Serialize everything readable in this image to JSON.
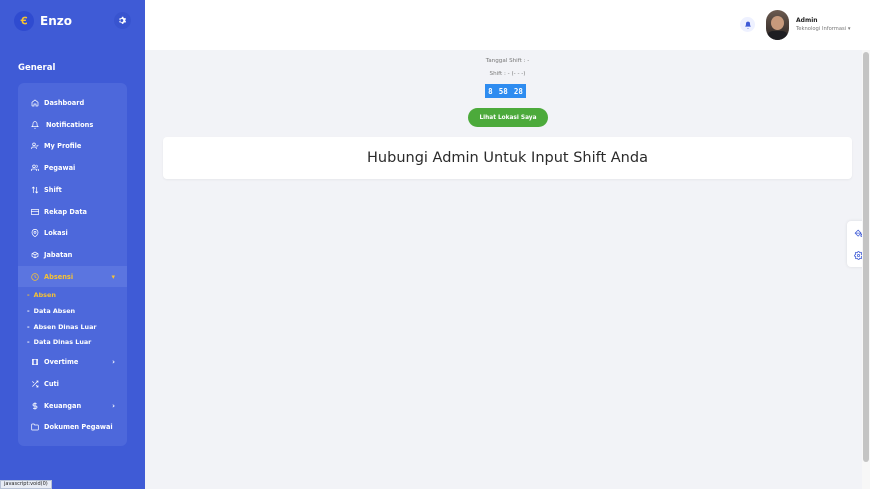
{
  "brand": {
    "name": "Enzo",
    "logo_glyph": "ꞓ"
  },
  "sidebar": {
    "section": "General",
    "items": [
      {
        "label": "Dashboard",
        "icon": "home-icon"
      },
      {
        "label": "Notifications",
        "icon": "bell-icon"
      },
      {
        "label": "My Profile",
        "icon": "user-check-icon"
      },
      {
        "label": "Pegawai",
        "icon": "users-icon"
      },
      {
        "label": "Shift",
        "icon": "arrows-updown-icon"
      },
      {
        "label": "Rekap Data",
        "icon": "credit-card-icon"
      },
      {
        "label": "Lokasi",
        "icon": "map-pin-icon"
      },
      {
        "label": "Jabatan",
        "icon": "box-icon"
      },
      {
        "label": "Absensi",
        "icon": "clock-icon",
        "active": true
      },
      {
        "label": "Overtime",
        "icon": "film-icon"
      },
      {
        "label": "Cuti",
        "icon": "shuffle-icon"
      },
      {
        "label": "Keuangan",
        "icon": "dollar-icon"
      },
      {
        "label": "Dokumen Pegawai",
        "icon": "folder-icon"
      }
    ],
    "subitems": [
      {
        "label": "Absen",
        "active": true
      },
      {
        "label": "Data Absen"
      },
      {
        "label": "Absen Dinas Luar"
      },
      {
        "label": "Data Dinas Luar"
      }
    ]
  },
  "header": {
    "user_name": "Admin",
    "user_role": "Teknologi Informasi"
  },
  "main": {
    "shift_date": "Tanggal Shift : -",
    "shift_time": "Shift : - (- - -)",
    "clock": {
      "hours": "8",
      "minutes": "58",
      "seconds": "28"
    },
    "location_button": "Lihat Lokasi Saya",
    "message": "Hubungi Admin Untuk Input Shift Anda"
  },
  "status_bar": "javascript:void(0)",
  "colors": {
    "sidebar": "#3f5bd6",
    "accent": "#f6c233",
    "clock": "#2e8cf0",
    "button": "#4caa3b"
  }
}
